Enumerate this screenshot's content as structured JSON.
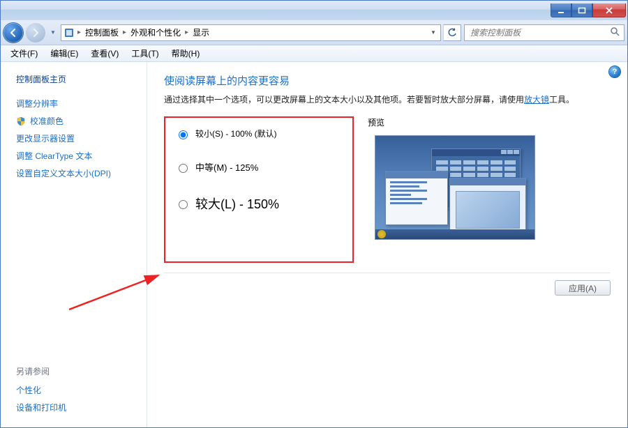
{
  "breadcrumb": {
    "seg1": "控制面板",
    "seg2": "外观和个性化",
    "seg3": "显示"
  },
  "search": {
    "placeholder": "搜索控制面板"
  },
  "menu": {
    "file": "文件(F)",
    "edit": "编辑(E)",
    "view": "查看(V)",
    "tools": "工具(T)",
    "help": "帮助(H)"
  },
  "sidebar": {
    "heading": "控制面板主页",
    "links": {
      "resolution": "调整分辨率",
      "calibrate": "校准颜色",
      "monitor": "更改显示器设置",
      "cleartype": "调整 ClearType 文本",
      "custom_dpi": "设置自定义文本大小(DPI)"
    },
    "see_also": "另请参阅",
    "see_also_links": {
      "personalize": "个性化",
      "devices": "设备和打印机"
    }
  },
  "main": {
    "title": "使阅读屏幕上的内容更容易",
    "desc_pre": "通过选择其中一个选项，可以更改屏幕上的文本大小以及其他项。若要暂时放大部分屏幕，请使用",
    "desc_link": "放大镜",
    "desc_post": "工具。",
    "options": {
      "small": "较小(S) - 100% (默认)",
      "medium": "中等(M) - 125%",
      "large": "较大(L) - 150%"
    },
    "preview_label": "预览",
    "apply": "应用(A)"
  },
  "help_tooltip": "?"
}
